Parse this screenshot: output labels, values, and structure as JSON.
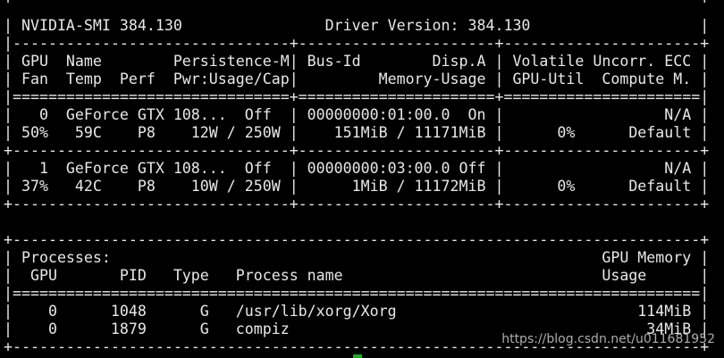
{
  "terminal": {
    "lines": [
      "+-----------------------------------------------------------------------------+",
      "| NVIDIA-SMI 384.130                Driver Version: 384.130                   |",
      "|-------------------------------+----------------------+----------------------+",
      "| GPU  Name        Persistence-M| Bus-Id        Disp.A | Volatile Uncorr. ECC |",
      "| Fan  Temp  Perf  Pwr:Usage/Cap|         Memory-Usage | GPU-Util  Compute M. |",
      "|===============================+======================+======================|",
      "|   0  GeForce GTX 108...  Off  | 00000000:01:00.0  On |                  N/A |",
      "| 50%   59C    P8    12W / 250W |    151MiB / 11171MiB |      0%      Default |",
      "+-------------------------------+----------------------+----------------------+",
      "|   1  GeForce GTX 108...  Off  | 00000000:03:00.0 Off |                  N/A |",
      "| 37%   42C    P8    10W / 250W |      1MiB / 11172MiB |      0%      Default |",
      "+-------------------------------+----------------------+----------------------+",
      "",
      "+-----------------------------------------------------------------------------+",
      "| Processes:                                                       GPU Memory |",
      "|  GPU       PID   Type   Process name                             Usage      |",
      "|=============================================================================|",
      "|    0      1048      G   /usr/lib/xorg/Xorg                           114MiB |",
      "|    0      1879      G   compiz                                        34MiB |",
      "+-----------------------------------------------------------------------------+"
    ]
  },
  "watermark": "https://blog.csdn.net/u011681952"
}
